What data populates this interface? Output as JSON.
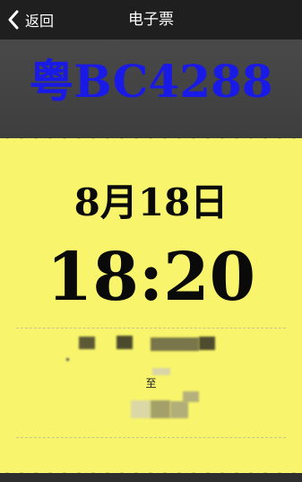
{
  "navbar": {
    "back_label": "返回",
    "title": "电子票"
  },
  "ticket": {
    "plate": "粤BC4288",
    "date": "8月18日",
    "time": "18:20",
    "to_label": "至"
  },
  "colors": {
    "plate_blue": "#1a1ae6",
    "ticket_yellow": "#f8f56c",
    "header_dark": "#1f1f1f",
    "background_gray": "#3b3b3b"
  },
  "icons": {
    "back": "chevron-left-icon"
  }
}
